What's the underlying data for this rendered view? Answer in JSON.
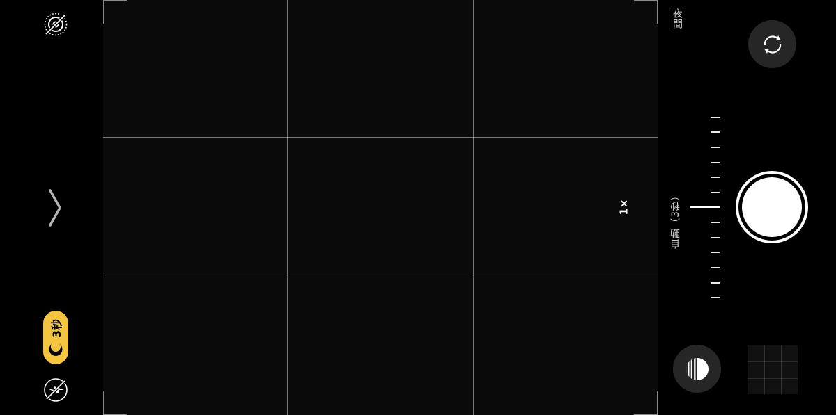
{
  "viewfinder": {
    "zoom_label": "1×"
  },
  "left_controls": {
    "live_photo_icon": "live-photo-off-icon",
    "expand_icon": "chevron-right-icon",
    "night_mode": {
      "label": "3秒",
      "icon": "night-mode-moon-icon",
      "color": "#f2c43f"
    },
    "flash_icon": "flash-off-icon"
  },
  "right_controls": {
    "mode_label": "夜間",
    "flip_icon": "flip-camera-icon",
    "exposure_dial": {
      "label": "自動（3秒）"
    },
    "shutter_icon": "shutter-button",
    "night_exposure_icon": "night-mode-moon-icon",
    "thumbnail": "last-photo-thumbnail"
  }
}
